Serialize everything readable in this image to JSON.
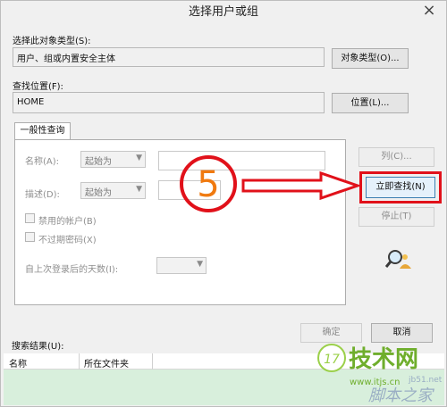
{
  "window": {
    "title": "选择用户或组",
    "close_glyph": "×"
  },
  "object_type": {
    "label": "选择此对象类型(S):",
    "value": "用户、组或内置安全主体",
    "button": "对象类型(O)..."
  },
  "location": {
    "label": "查找位置(F):",
    "value": "HOME",
    "button": "位置(L)..."
  },
  "tab": {
    "label": "一般性查询"
  },
  "query": {
    "name_label": "名称(A):",
    "name_mode": "起始为",
    "desc_label": "描述(D):",
    "desc_mode": "起始为",
    "disabled_accounts": "禁用的帐户(B)",
    "no_expire_password": "不过期密码(X)",
    "days_since_logon": "自上次登录后的天数(I):"
  },
  "side_buttons": {
    "columns": "列(C)...",
    "find_now": "立即查找(N)",
    "stop": "停止(T)"
  },
  "footer": {
    "ok": "确定",
    "cancel": "取消"
  },
  "results": {
    "label": "搜索结果(U):",
    "columns": [
      "名称",
      "所在文件夹"
    ]
  },
  "annotation": {
    "step_number": "5",
    "accent_color": "#e1111a"
  },
  "watermark": {
    "brand": "技术网",
    "url": "www.itjs.cn",
    "site": "脚本之家",
    "domain": "jb51.net",
    "prefix": "17"
  },
  "icons": {
    "search_icon": "magnifier-people-icon",
    "dropdown": "chevron-down-icon",
    "arrow": "right-arrow-icon"
  }
}
